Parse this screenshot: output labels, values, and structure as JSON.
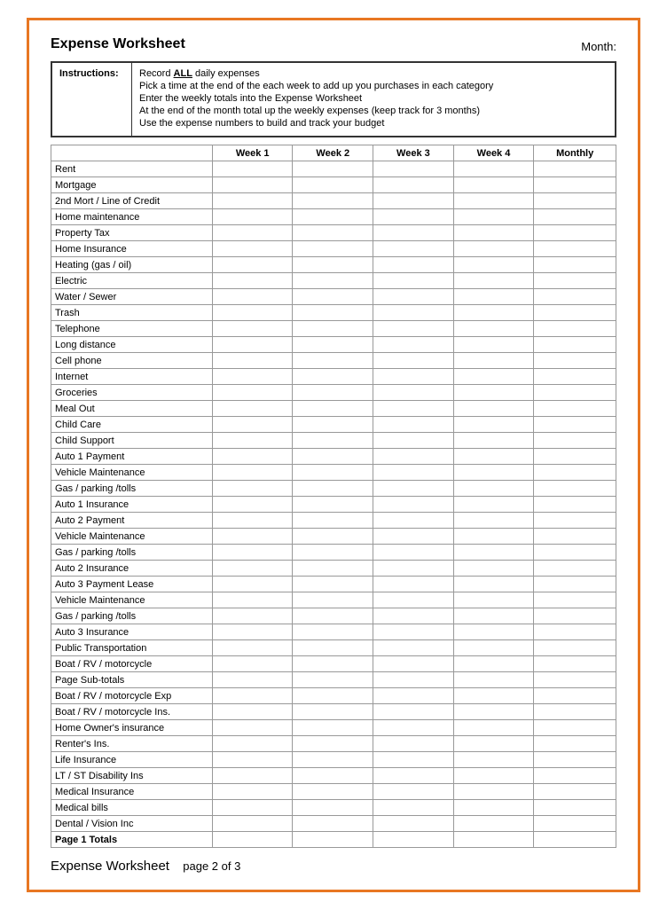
{
  "title": "Expense Worksheet",
  "month_label": "Month:",
  "instructions": {
    "title": "Instructions:",
    "items": [
      {
        "text": "Record ",
        "bold": "ALL",
        "rest": " daily expenses"
      },
      {
        "text": "Pick a time at the end of the each week to add up you purchases in each category"
      },
      {
        "text": "Enter the weekly totals into the Expense Worksheet"
      },
      {
        "text": "At the end of the month total up the weekly expenses (keep track for 3 months)"
      },
      {
        "text": "Use the expense numbers to build and track your budget"
      }
    ]
  },
  "columns": [
    "",
    "Week 1",
    "Week 2",
    "Week 3",
    "Week 4",
    "Monthly"
  ],
  "rows": [
    "Rent",
    "Mortgage",
    "2nd Mort / Line of Credit",
    "Home maintenance",
    "Property Tax",
    "Home Insurance",
    "Heating (gas / oil)",
    "Electric",
    "Water / Sewer",
    "Trash",
    "Telephone",
    "Long distance",
    "Cell phone",
    "Internet",
    "Groceries",
    "Meal Out",
    "Child Care",
    "Child Support",
    "Auto 1 Payment",
    "Vehicle Maintenance",
    "Gas / parking /tolls",
    "Auto 1 Insurance",
    "Auto 2 Payment",
    "Vehicle Maintenance",
    "Gas / parking /tolls",
    "Auto 2 Insurance",
    "Auto 3 Payment Lease",
    "Vehicle Maintenance",
    "Gas / parking /tolls",
    "Auto 3 Insurance",
    "Public Transportation",
    "Boat / RV / motorcycle",
    "Page Sub-totals",
    "Boat / RV / motorcycle Exp",
    "Boat / RV / motorcycle Ins.",
    "Home Owner's insurance",
    "Renter's Ins.",
    "Life Insurance",
    "LT / ST Disability Ins",
    "Medical Insurance",
    "Medical bills",
    "Dental / Vision Inc"
  ],
  "last_row": "Page 1 Totals",
  "footer_title": "Expense Worksheet",
  "footer_page": "page 2 of 3"
}
